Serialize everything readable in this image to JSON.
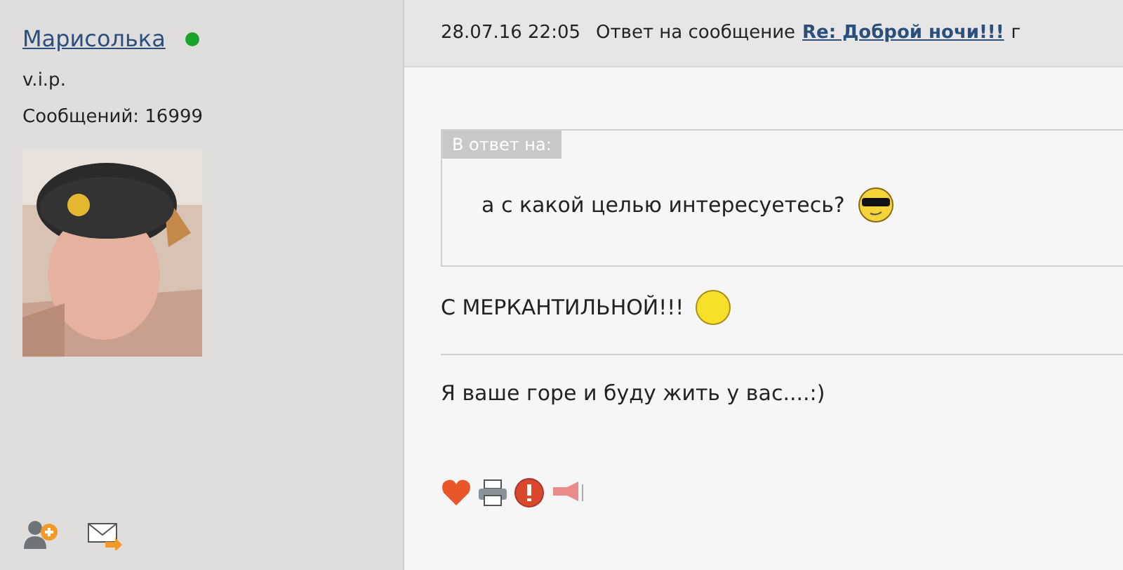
{
  "author": {
    "name": "Марисолька",
    "online": true,
    "rank": "v.i.p.",
    "posts": "Сообщений: 16999"
  },
  "post": {
    "date": "28.07.16 22:05",
    "reply_label": "Ответ на сообщение",
    "reply_link": "Re: Доброй ночи!!!",
    "trailing": "г",
    "quote": {
      "label": "В ответ на:",
      "text": "а с какой целью интересуетесь?"
    },
    "lines": [
      "С МЕРКАНТИЛЬНОЙ!!!",
      "Я ваше горе и буду жить у вас....:)"
    ]
  }
}
